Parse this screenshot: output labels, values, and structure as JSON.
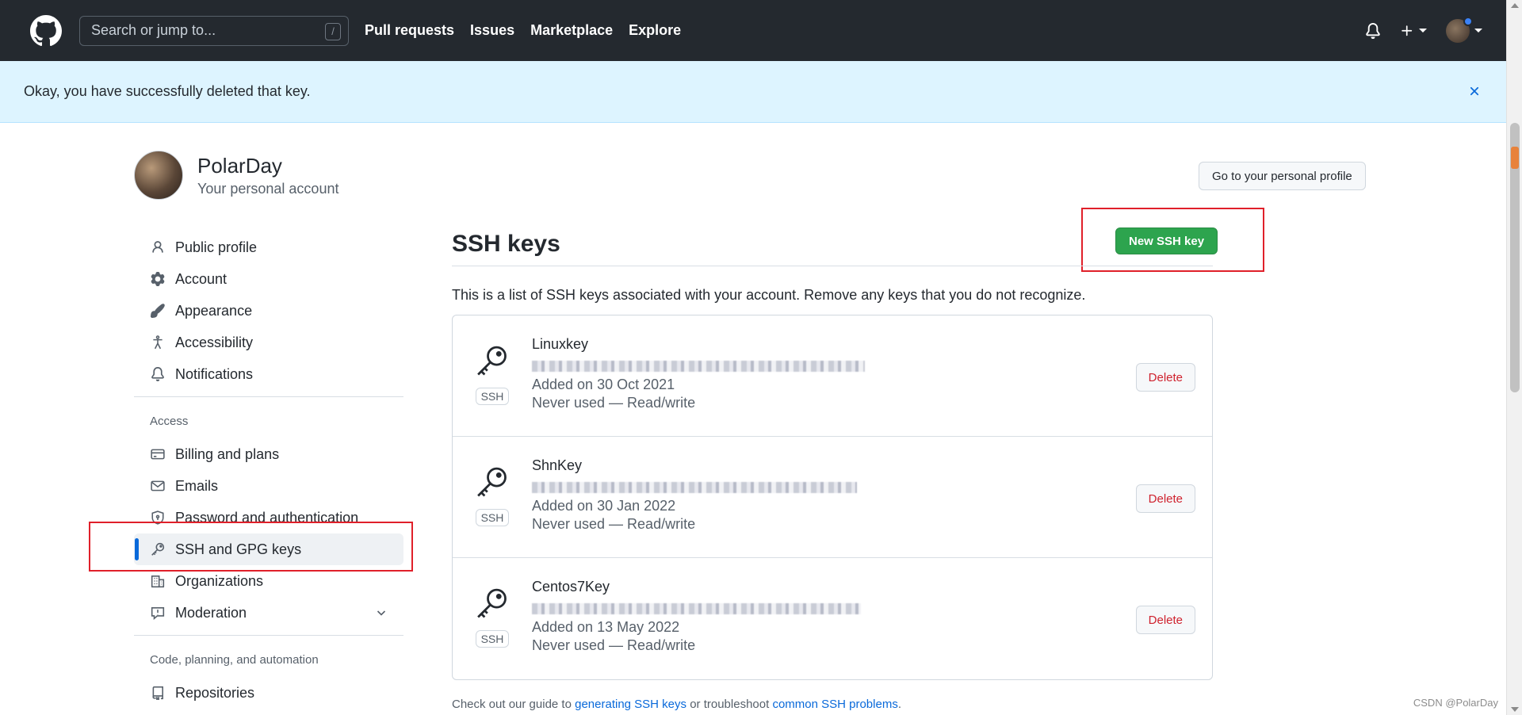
{
  "header": {
    "search_placeholder": "Search or jump to...",
    "slash_hint": "/",
    "nav": [
      "Pull requests",
      "Issues",
      "Marketplace",
      "Explore"
    ]
  },
  "flash": {
    "message": "Okay, you have successfully deleted that key."
  },
  "account": {
    "name": "PolarDay",
    "subtitle": "Your personal account",
    "profile_button": "Go to your personal profile"
  },
  "sidebar": {
    "items_top": [
      {
        "label": "Public profile",
        "icon": "person-icon"
      },
      {
        "label": "Account",
        "icon": "gear-icon"
      },
      {
        "label": "Appearance",
        "icon": "paintbrush-icon"
      },
      {
        "label": "Accessibility",
        "icon": "accessibility-icon"
      },
      {
        "label": "Notifications",
        "icon": "bell-icon"
      }
    ],
    "access_heading": "Access",
    "items_access": [
      {
        "label": "Billing and plans",
        "icon": "credit-card-icon"
      },
      {
        "label": "Emails",
        "icon": "mail-icon"
      },
      {
        "label": "Password and authentication",
        "icon": "shield-lock-icon"
      },
      {
        "label": "SSH and GPG keys",
        "icon": "key-icon"
      },
      {
        "label": "Organizations",
        "icon": "organization-icon"
      },
      {
        "label": "Moderation",
        "icon": "report-icon"
      }
    ],
    "code_heading": "Code, planning, and automation",
    "items_code": [
      {
        "label": "Repositories",
        "icon": "repo-icon"
      }
    ]
  },
  "main": {
    "title": "SSH keys",
    "new_button": "New SSH key",
    "description": "This is a list of SSH keys associated with your account. Remove any keys that you do not recognize.",
    "keys": [
      {
        "title": "Linuxkey",
        "type": "SSH",
        "added": "Added on 30 Oct 2021",
        "usage": "Never used — Read/write",
        "delete": "Delete"
      },
      {
        "title": "ShnKey",
        "type": "SSH",
        "added": "Added on 30 Jan 2022",
        "usage": "Never used — Read/write",
        "delete": "Delete"
      },
      {
        "title": "Centos7Key",
        "type": "SSH",
        "added": "Added on 13 May 2022",
        "usage": "Never used — Read/write",
        "delete": "Delete"
      }
    ],
    "footer": {
      "prefix": "Check out our guide to ",
      "link1": "generating SSH keys",
      "middle": " or troubleshoot ",
      "link2": "common SSH problems",
      "suffix": "."
    }
  },
  "watermark": "CSDN @PolarDay",
  "colors": {
    "header_bg": "#24292f",
    "flash_bg": "#ddf4ff",
    "primary_green": "#2da44e",
    "danger": "#cf222e",
    "link": "#0969da",
    "highlight_box": "#e0202a"
  }
}
